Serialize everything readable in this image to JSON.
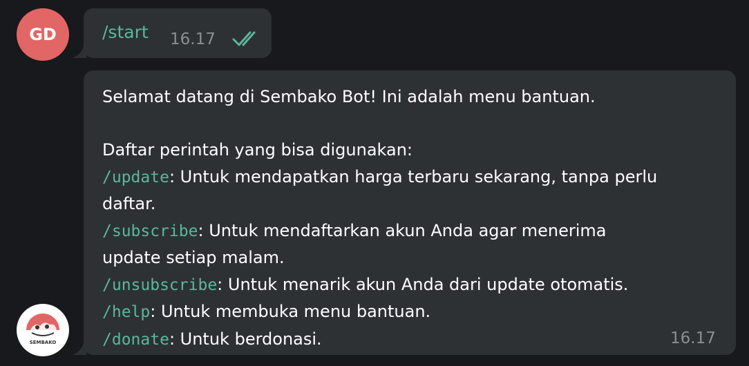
{
  "user_message": {
    "avatar_initials": "GD",
    "avatar_color": "#e26665",
    "text": "/start",
    "time": "16.17",
    "status_icon": "double-check-icon"
  },
  "bot_message": {
    "avatar_icon": "sembako-logo-icon",
    "avatar_logo_text": "SEMBAKO",
    "intro": "Selamat datang di Sembako Bot! Ini adalah menu bantuan.",
    "list_header": "Daftar perintah yang bisa digunakan:",
    "commands": [
      {
        "cmd": "/update",
        "line1": ": Untuk mendapatkan harga terbaru sekarang, tanpa perlu",
        "line2": "daftar."
      },
      {
        "cmd": "/subscribe",
        "line1": ": Untuk mendaftarkan akun Anda agar menerima",
        "line2": "update setiap malam."
      },
      {
        "cmd": "/unsubscribe",
        "line1": ": Untuk menarik akun Anda dari update otomatis."
      },
      {
        "cmd": "/help",
        "line1": ": Untuk membuka menu bantuan."
      },
      {
        "cmd": "/donate",
        "line1": ": Untuk berdonasi."
      }
    ],
    "time": "16.17"
  },
  "colors": {
    "background": "#17191c",
    "bubble": "#2d3134",
    "command": "#5ab89c",
    "time": "#8a8f94"
  }
}
